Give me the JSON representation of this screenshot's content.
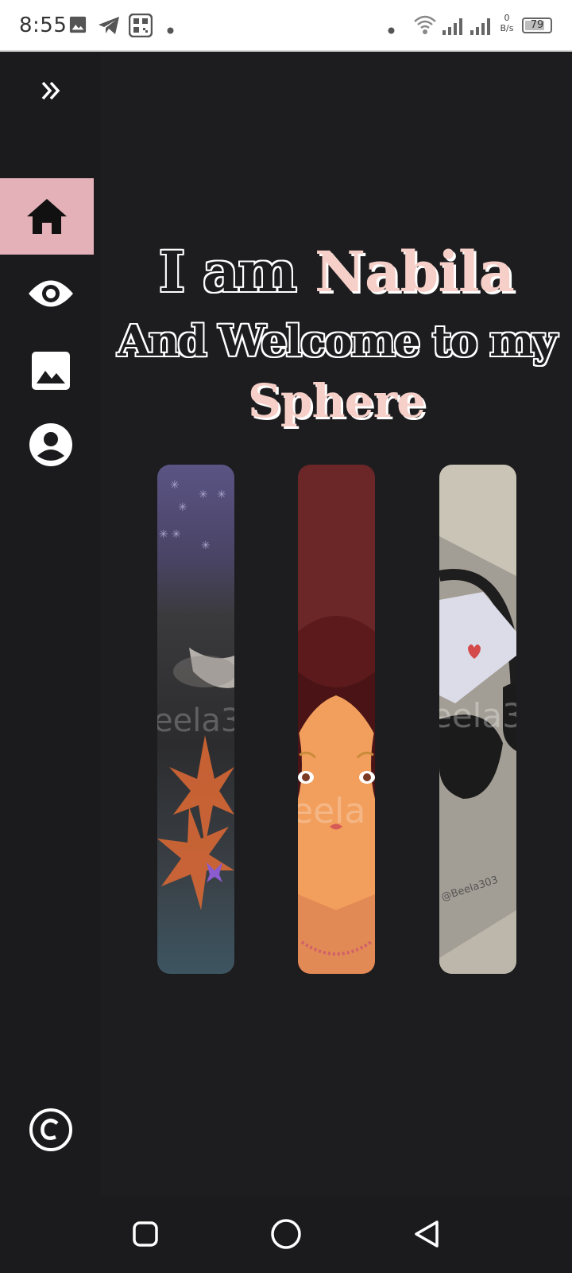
{
  "status_bar": {
    "time": "8:55",
    "net_speed_value": "0",
    "net_speed_unit": "B/s",
    "battery": "79",
    "battery_level": 0.79
  },
  "sidebar": {
    "expand_icon": "double-chevron-right-icon",
    "items": [
      {
        "name": "home",
        "icon": "home-icon",
        "active": true
      },
      {
        "name": "view",
        "icon": "eye-icon",
        "active": false
      },
      {
        "name": "gallery",
        "icon": "image-icon",
        "active": false
      },
      {
        "name": "profile",
        "icon": "account-circle-icon",
        "active": false
      }
    ],
    "footer_icon": "copyright-icon"
  },
  "hero": {
    "intro": "I am ",
    "name": "Nabila",
    "welcome": "And Welcome to my",
    "sphere": "Sphere"
  },
  "gallery": {
    "cards": [
      {
        "name": "artwork-night-flowers",
        "watermark": "eela3"
      },
      {
        "name": "artwork-portrait",
        "watermark": "eela"
      },
      {
        "name": "artwork-headphones",
        "watermark": "eela3",
        "signature": "@Beela303"
      }
    ]
  },
  "colors": {
    "background": "#1d1d1f",
    "sidebar": "#1b1b1d",
    "accent": "#f6d0c8",
    "active_nav": "#e4b1b8"
  },
  "nav_bar": {
    "buttons": [
      "recents-icon",
      "home-circle-icon",
      "back-triangle-icon"
    ]
  }
}
